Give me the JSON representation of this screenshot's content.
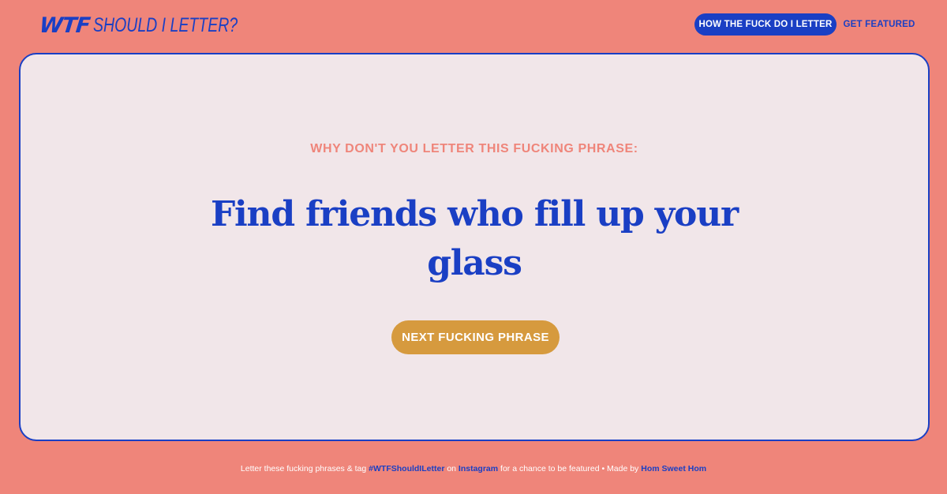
{
  "header": {
    "logo_wtf": "WTF",
    "logo_rest": "SHOULD I LETTER?",
    "nav_primary_label": "HOW THE FUCK DO I LETTER",
    "nav_secondary_label": "GET FEATURED"
  },
  "main": {
    "kicker": "WHY DON'T YOU LETTER THIS FUCKING PHRASE:",
    "phrase": "Find friends who fill up your glass",
    "next_button_label": "NEXT FUCKING PHRASE"
  },
  "footer": {
    "text_1": "Letter these fucking phrases & tag ",
    "hashtag": "#WTFShouldILetter",
    "text_2": " on ",
    "instagram": "Instagram",
    "text_3": " for a chance to be featured • Made by ",
    "maker": "Hom Sweet Hom"
  },
  "colors": {
    "background": "#ef857a",
    "card": "#f1e6e9",
    "brand_blue": "#1a3fc4",
    "button_gold": "#d69a3e"
  }
}
